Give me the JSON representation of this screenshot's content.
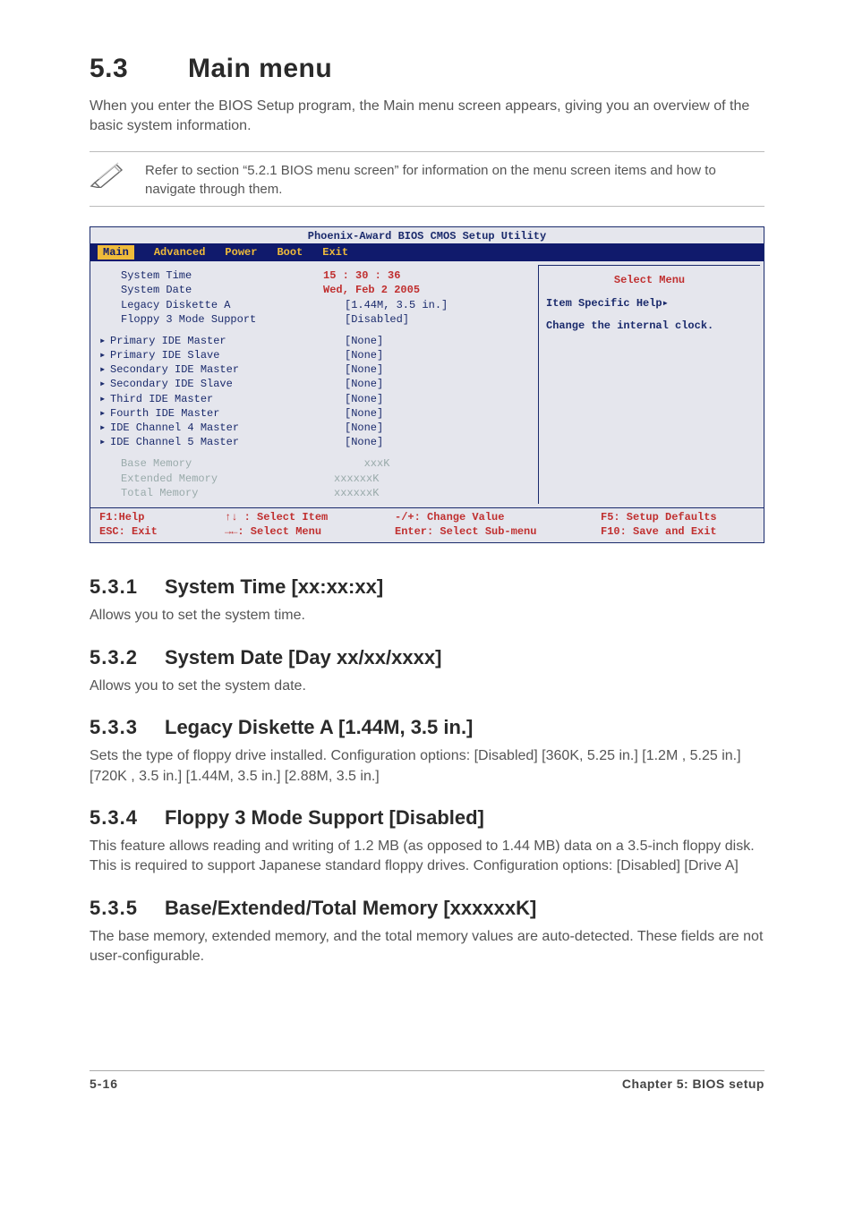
{
  "section": {
    "number": "5.3",
    "title": "Main menu",
    "intro": "When you enter the BIOS Setup program, the Main menu screen appears, giving you an overview of the basic system information.",
    "note": "Refer to section “5.2.1  BIOS menu screen” for information on the menu screen items and how to navigate through them."
  },
  "bios": {
    "window_title": "Phoenix-Award BIOS CMOS Setup Utility",
    "menubar": [
      "Main",
      "Advanced",
      "Power",
      "Boot",
      "Exit"
    ],
    "active_tab": "Main",
    "rows_top": [
      {
        "label": "System Time",
        "value": "15 : 30 : 36",
        "red": true
      },
      {
        "label": "System Date",
        "value": "Wed, Feb 2 2005",
        "red": true
      },
      {
        "label": "Legacy Diskette A",
        "value": "[1.44M, 3.5 in.]"
      },
      {
        "label": "Floppy 3 Mode Support",
        "value": "[Disabled]"
      }
    ],
    "rows_ide": [
      {
        "label": "Primary IDE Master",
        "value": "[None]"
      },
      {
        "label": "Primary IDE Slave",
        "value": "[None]"
      },
      {
        "label": "Secondary IDE Master",
        "value": "[None]"
      },
      {
        "label": "Secondary IDE Slave",
        "value": "[None]"
      },
      {
        "label": "Third IDE Master",
        "value": "[None]"
      },
      {
        "label": "Fourth IDE Master",
        "value": "[None]"
      },
      {
        "label": "IDE Channel 4 Master",
        "value": "[None]"
      },
      {
        "label": "IDE Channel 5 Master",
        "value": "[None]"
      }
    ],
    "rows_mem": [
      {
        "label": "Base Memory",
        "value": "   xxxK"
      },
      {
        "label": "Extended Memory",
        "value": "xxxxxxK"
      },
      {
        "label": "Total Memory",
        "value": "xxxxxxK"
      }
    ],
    "help": {
      "title": "Select Menu",
      "line1": "Item Specific Help▸",
      "line2": "Change the internal clock."
    },
    "footer": {
      "r1c1": "F1:Help",
      "r1c2": "↑↓ : Select Item",
      "r1c3": "-/+:  Change Value",
      "r1c4": "F5: Setup Defaults",
      "r2c1": "ESC: Exit",
      "r2c2": "→←: Select Menu",
      "r2c3": "Enter: Select Sub-menu",
      "r2c4": "F10: Save and Exit"
    }
  },
  "subs": [
    {
      "num": "5.3.1",
      "title": "System Time [xx:xx:xx]",
      "body": "Allows you to set the system time."
    },
    {
      "num": "5.3.2",
      "title": "System Date [Day xx/xx/xxxx]",
      "body": "Allows you to set the system date."
    },
    {
      "num": "5.3.3",
      "title": "Legacy Diskette A [1.44M, 3.5 in.]",
      "body": "Sets the type of floppy drive installed. Configuration options: [Disabled] [360K, 5.25 in.] [1.2M , 5.25 in.] [720K , 3.5 in.] [1.44M, 3.5 in.] [2.88M, 3.5 in.]"
    },
    {
      "num": "5.3.4",
      "title": "Floppy 3 Mode Support [Disabled]",
      "body": "This feature allows reading and writing of 1.2 MB (as opposed to 1.44 MB) data on a 3.5-inch floppy disk. This is required to support Japanese standard floppy drives. Configuration options: [Disabled] [Drive A]"
    },
    {
      "num": "5.3.5",
      "title": "Base/Extended/Total Memory [xxxxxxK]",
      "body": "The base memory, extended memory, and the total memory values are auto-detected. These fields are not user-configurable."
    }
  ],
  "page_footer": {
    "left": "5-16",
    "right": "Chapter 5: BIOS setup"
  }
}
